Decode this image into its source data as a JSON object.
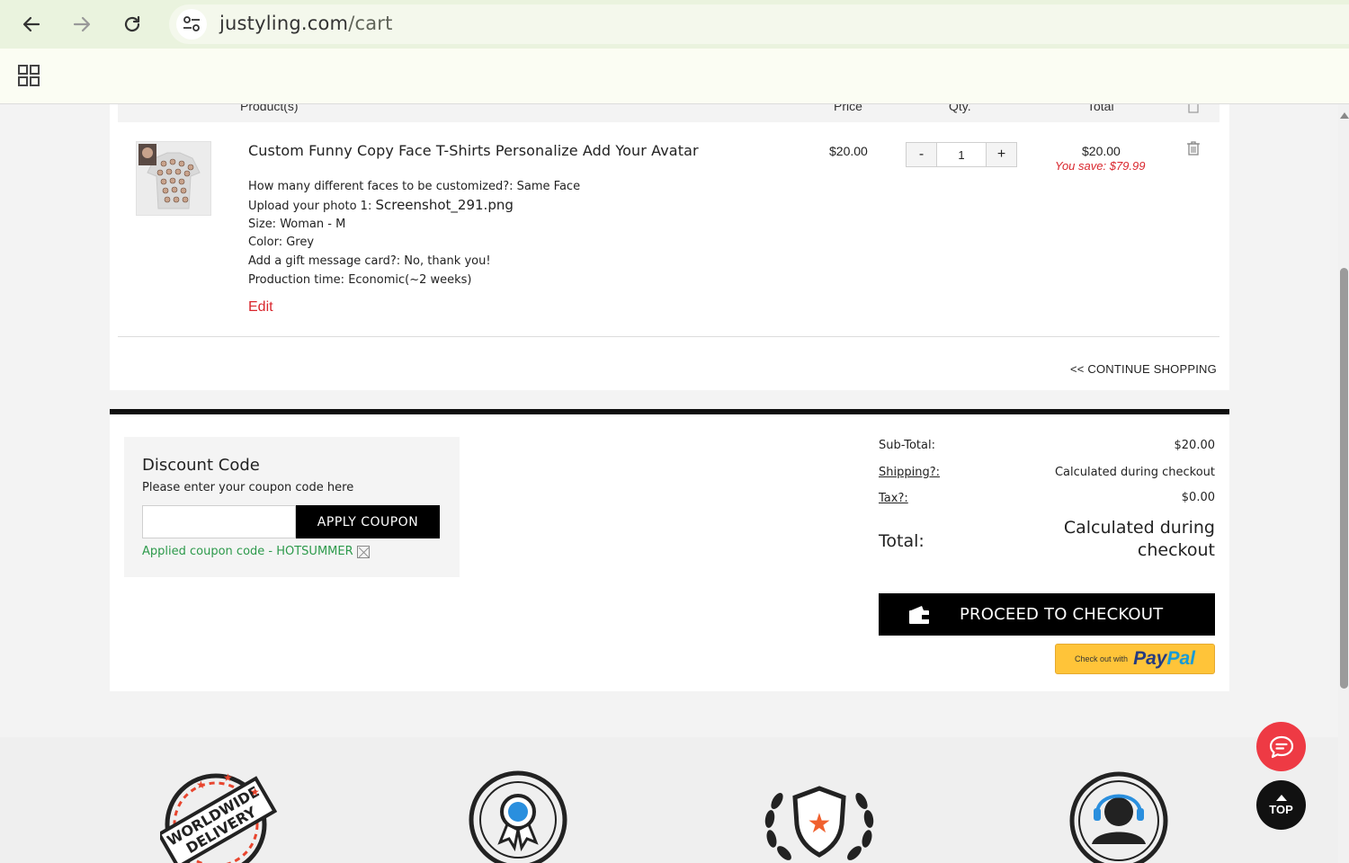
{
  "browser": {
    "url_host": "justyling.com",
    "url_path": "/cart"
  },
  "cart": {
    "header": {
      "product_col": "Product(s)",
      "price_col": "Price",
      "qty_col": "Qty.",
      "total_col": "Total"
    },
    "item": {
      "title": "Custom Funny Copy Face T-Shirts Personalize Add Your Avatar",
      "options": [
        {
          "label": "How many different faces to be customized?: ",
          "value": "Same Face"
        },
        {
          "label": "Upload your photo 1: ",
          "value": "Screenshot_291.png"
        },
        {
          "label": "Size: ",
          "value": "Woman - M"
        },
        {
          "label": "Color: ",
          "value": "Grey"
        },
        {
          "label": "Add a gift message card?: ",
          "value": "No, thank you!"
        },
        {
          "label": "Production time: ",
          "value": "Economic(~2 weeks)"
        }
      ],
      "edit_label": "Edit",
      "price": "$20.00",
      "qty_minus": "-",
      "qty": "1",
      "qty_plus": "+",
      "line_total": "$20.00",
      "you_save": "You save: $79.99"
    },
    "continue_label": "<< CONTINUE SHOPPING"
  },
  "discount": {
    "title": "Discount Code",
    "subtitle": "Please enter your coupon code here",
    "input_value": "",
    "apply_label": "APPLY COUPON",
    "applied_text": "Applied coupon code - HOTSUMMER"
  },
  "summary": {
    "subtotal_label": "Sub-Total:",
    "subtotal_value": "$20.00",
    "shipping_label": "Shipping?:",
    "shipping_value": "Calculated during checkout",
    "tax_label": "Tax?:",
    "tax_value": "$0.00",
    "total_label": "Total:",
    "total_value": "Calculated during checkout",
    "checkout_label": "PROCEED TO CHECKOUT",
    "paypal_small": "Check out with",
    "paypal_pay": "Pay",
    "paypal_pal": "Pal"
  },
  "footer": {
    "badge1": {
      "line1": "WORLDWIDE",
      "line2": "DELIVERY"
    }
  },
  "floating": {
    "top_label": "TOP"
  },
  "colors": {
    "accent_red": "#d9262d",
    "coupon_green": "#2d9a4b",
    "paypal_yellow": "#ffc439"
  }
}
